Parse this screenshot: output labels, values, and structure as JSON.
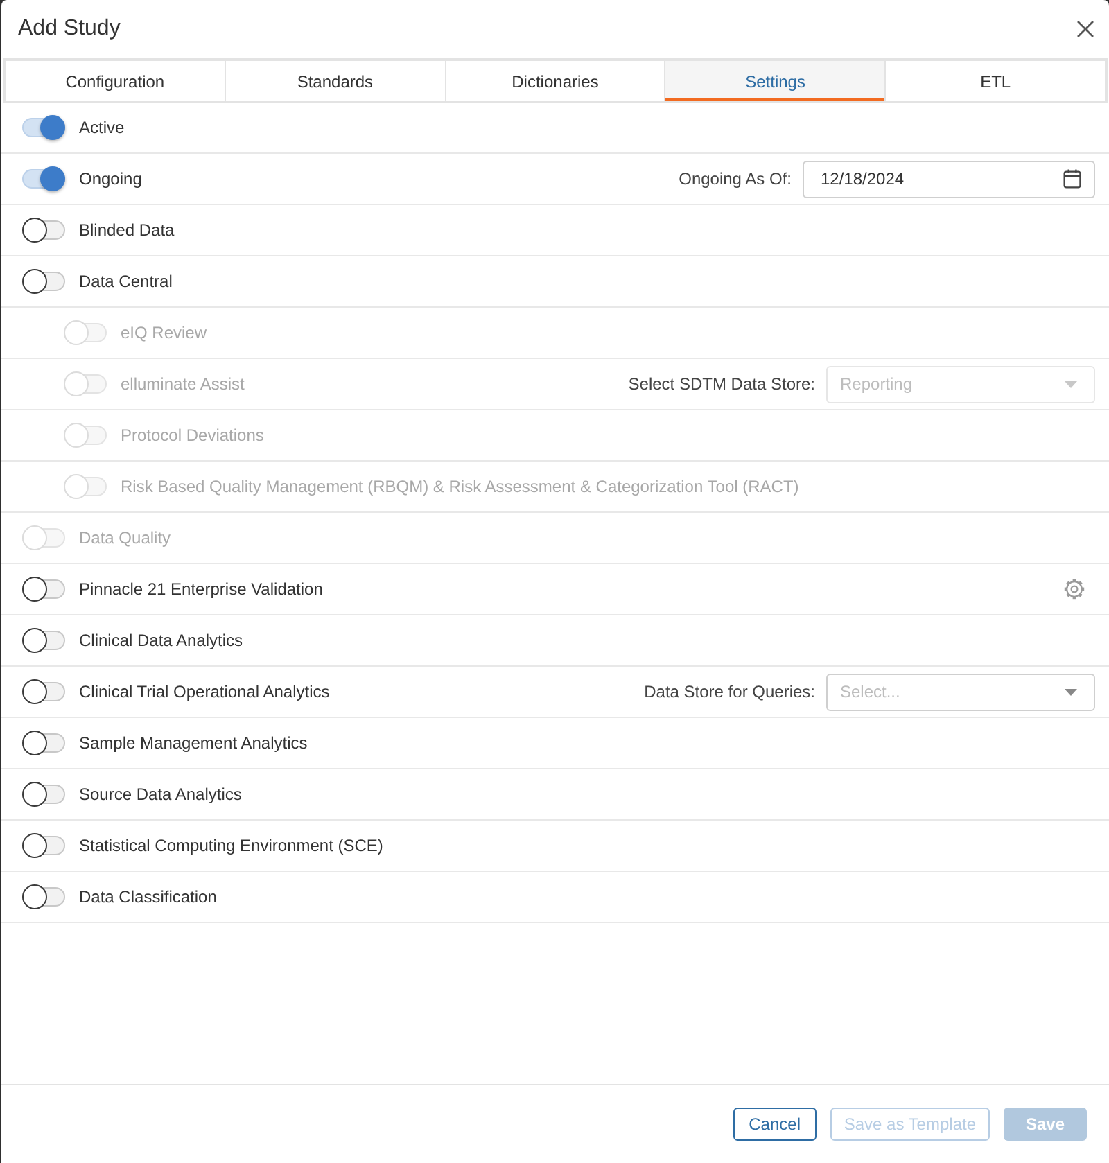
{
  "dialog": {
    "title": "Add Study"
  },
  "tabs": [
    {
      "label": "Configuration",
      "selected": false
    },
    {
      "label": "Standards",
      "selected": false
    },
    {
      "label": "Dictionaries",
      "selected": false
    },
    {
      "label": "Settings",
      "selected": true
    },
    {
      "label": "ETL",
      "selected": false
    }
  ],
  "rows": [
    {
      "kind": "plain",
      "label": "Active",
      "on": true,
      "disabled": false
    },
    {
      "kind": "date",
      "label": "Ongoing",
      "on": true,
      "disabled": false,
      "field": {
        "label": "Ongoing As Of:",
        "value": "12/18/2024"
      }
    },
    {
      "kind": "plain",
      "label": "Blinded Data",
      "on": false,
      "disabled": false
    },
    {
      "kind": "plain",
      "label": "Data Central",
      "on": false,
      "disabled": false,
      "children": [
        {
          "kind": "plain",
          "label": "eIQ Review",
          "on": false,
          "disabled": true
        },
        {
          "kind": "select",
          "label": "elluminate Assist",
          "on": false,
          "disabled": true,
          "field": {
            "label": "Select SDTM Data Store:",
            "value": "Reporting",
            "disabled": true
          }
        },
        {
          "kind": "plain",
          "label": "Protocol Deviations",
          "on": false,
          "disabled": true
        },
        {
          "kind": "plain",
          "label": "Risk Based Quality Management (RBQM) & Risk Assessment & Categorization Tool (RACT)",
          "on": false,
          "disabled": true
        }
      ]
    },
    {
      "kind": "plain",
      "label": "Data Quality",
      "on": false,
      "disabled": true
    },
    {
      "kind": "settings",
      "label": "Pinnacle 21 Enterprise Validation",
      "on": false,
      "disabled": false
    },
    {
      "kind": "plain",
      "label": "Clinical Data Analytics",
      "on": false,
      "disabled": false
    },
    {
      "kind": "select",
      "label": "Clinical Trial Operational Analytics",
      "on": false,
      "disabled": false,
      "field": {
        "label": "Data Store for Queries:",
        "placeholder": "Select...",
        "disabled": false
      }
    },
    {
      "kind": "plain",
      "label": "Sample Management Analytics",
      "on": false,
      "disabled": false
    },
    {
      "kind": "plain",
      "label": "Source Data Analytics",
      "on": false,
      "disabled": false
    },
    {
      "kind": "plain",
      "label": "Statistical Computing Environment (SCE)",
      "on": false,
      "disabled": false
    },
    {
      "kind": "plain",
      "label": "Data Classification",
      "on": false,
      "disabled": false
    }
  ],
  "buttons": [
    {
      "kind": "outline",
      "label": "Cancel",
      "disabled": false
    },
    {
      "kind": "outline",
      "label": "Save as Template",
      "disabled": true
    },
    {
      "kind": "primary",
      "label": "Save",
      "disabled": true
    }
  ]
}
